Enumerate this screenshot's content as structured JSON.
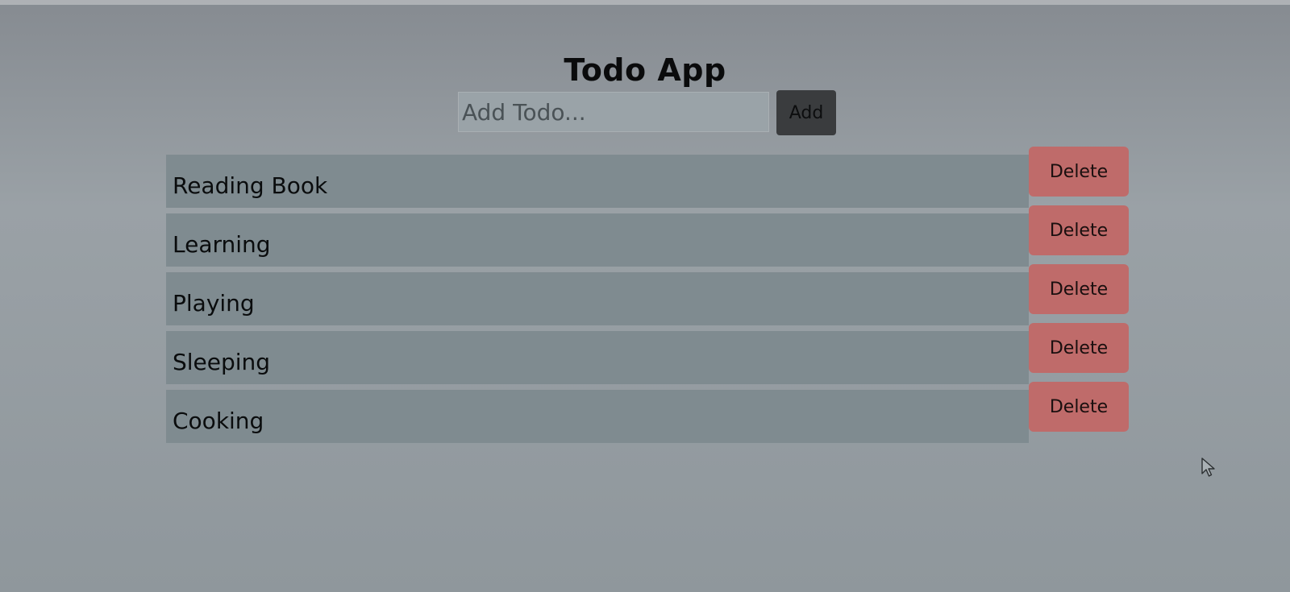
{
  "app": {
    "title": "Todo App"
  },
  "add_form": {
    "input_placeholder": "Add Todo...",
    "input_value": "",
    "add_label": "Add"
  },
  "todos": [
    {
      "text": "Reading Book",
      "delete_label": "Delete"
    },
    {
      "text": "Learning",
      "delete_label": "Delete"
    },
    {
      "text": "Playing",
      "delete_label": "Delete"
    },
    {
      "text": "Sleeping",
      "delete_label": "Delete"
    },
    {
      "text": "Cooking",
      "delete_label": "Delete"
    }
  ],
  "colors": {
    "delete_button": "#bf6b6a",
    "add_button": "#3a3c3e",
    "todo_row": "#7f8b90"
  },
  "icons": {
    "cursor": "mouse-pointer-icon"
  }
}
